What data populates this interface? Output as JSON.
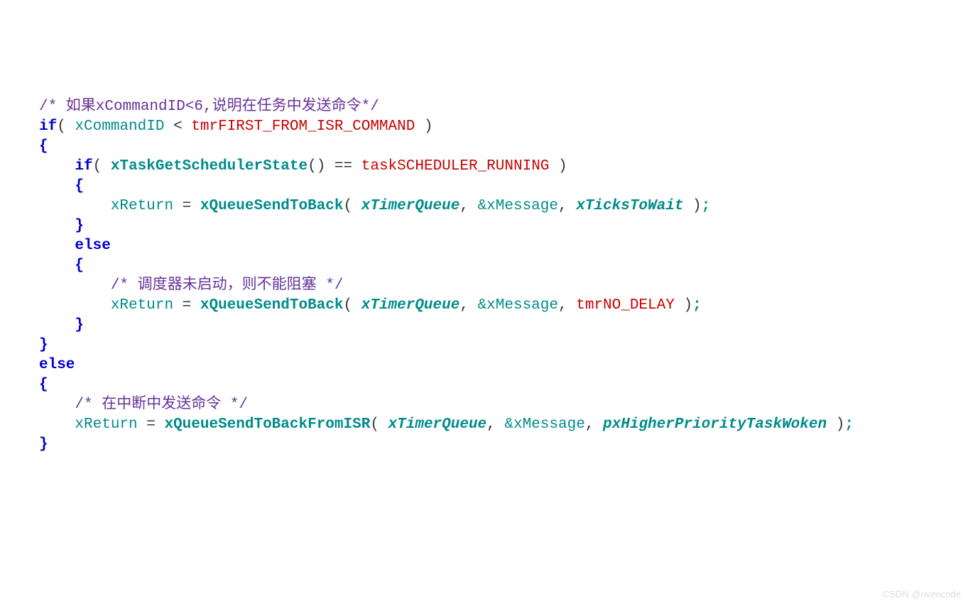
{
  "lines": {
    "l1_comment": "/* 如果xCommandID<6,说明在任务中发送命令*/",
    "l2_if": "if",
    "l2_open": "( ",
    "l2_var": "xCommandID",
    "l2_lt": " < ",
    "l2_const": "tmrFIRST_FROM_ISR_COMMAND",
    "l2_close": " )",
    "l3_brace": "{",
    "l4_if": "if",
    "l4_open": "( ",
    "l4_func": "xTaskGetSchedulerState",
    "l4_paren": "()",
    "l4_eq": " == ",
    "l4_const": "taskSCHEDULER_RUNNING",
    "l4_close": " )",
    "l5_brace": "{",
    "l6_var": "xReturn",
    "l6_eq": " = ",
    "l6_func": "xQueueSendToBack",
    "l6_open": "( ",
    "l6_arg1": "xTimerQueue",
    "l6_c1": ", ",
    "l6_amp": "&",
    "l6_arg2": "xMessage",
    "l6_c2": ", ",
    "l6_arg3": "xTicksToWait",
    "l6_close": " )",
    "l6_semi": ";",
    "l7_brace": "}",
    "l8_else": "else",
    "l9_brace": "{",
    "l10_comment": "/* 调度器未启动，则不能阻塞 */",
    "l11_var": "xReturn",
    "l11_eq": " = ",
    "l11_func": "xQueueSendToBack",
    "l11_open": "( ",
    "l11_arg1": "xTimerQueue",
    "l11_c1": ", ",
    "l11_amp": "&",
    "l11_arg2": "xMessage",
    "l11_c2": ", ",
    "l11_arg3": "tmrNO_DELAY",
    "l11_close": " )",
    "l11_semi": ";",
    "l12_brace": "}",
    "l13_brace": "}",
    "l14_else": "else",
    "l15_brace": "{",
    "l16_comment": "/* 在中断中发送命令 */",
    "l17_var": "xReturn",
    "l17_eq": " = ",
    "l17_func": "xQueueSendToBackFromISR",
    "l17_open": "( ",
    "l17_arg1": "xTimerQueue",
    "l17_c1": ", ",
    "l17_amp": "&",
    "l17_arg2": "xMessage",
    "l17_c2": ", ",
    "l17_arg3": "pxHigherPriorityTaskWoken",
    "l17_close": " )",
    "l17_semi": ";",
    "l18_brace": "}"
  },
  "watermark": "CSDN @rivencode"
}
